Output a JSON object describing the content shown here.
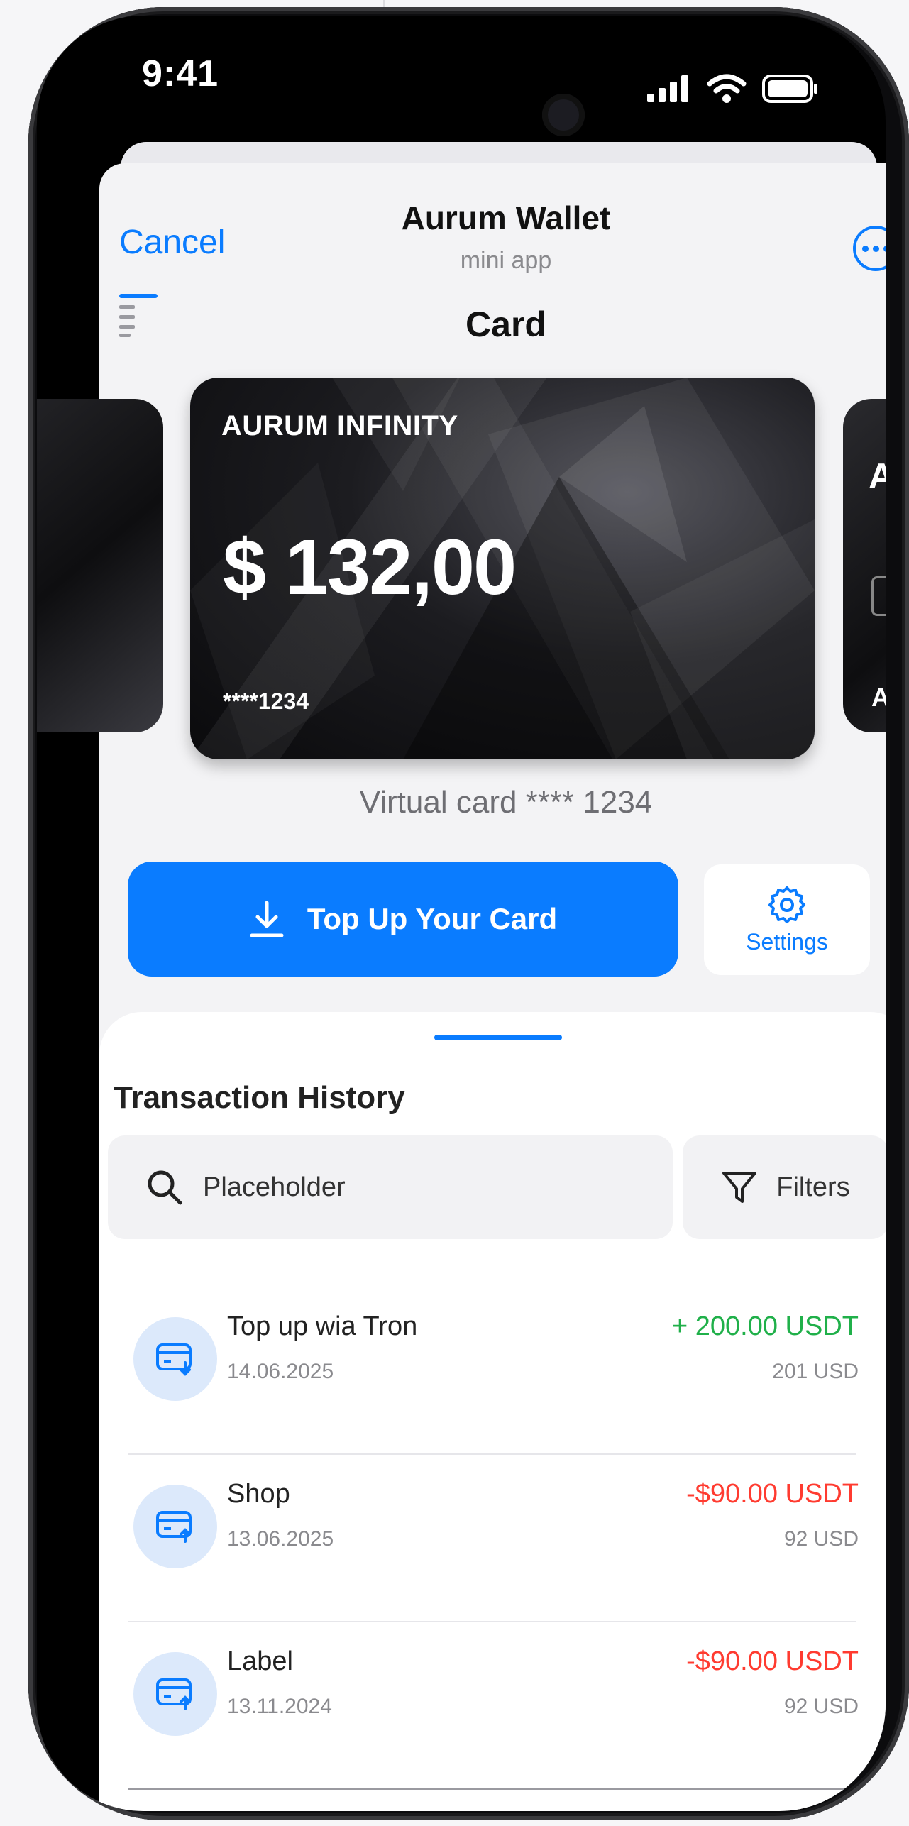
{
  "status_bar": {
    "time": "9:41"
  },
  "header": {
    "cancel_label": "Cancel",
    "app_name": "Aurum Wallet",
    "app_subtitle": "mini app",
    "page_title": "Card"
  },
  "card": {
    "brand": "AURUM INFINITY",
    "balance": "$ 132,00",
    "masked_number": "****1234",
    "virtual_label": "Virtual card **** 1234",
    "next_card_logo": "A",
    "next_card_brand": "AU"
  },
  "actions": {
    "topup_label": "Top Up Your Card",
    "settings_label": "Settings"
  },
  "history": {
    "title": "Transaction History",
    "search_placeholder": "Placeholder",
    "filters_label": "Filters",
    "transactions": [
      {
        "name": "Top up wia Tron",
        "date": "14.06.2025",
        "amount": "+ 200.00 USDT",
        "sub_amount": "201 USD",
        "type": "incoming"
      },
      {
        "name": "Shop",
        "date": "13.06.2025",
        "amount": "-$90.00 USDT",
        "sub_amount": "92 USD",
        "type": "outgoing"
      },
      {
        "name": "Label",
        "date": "13.11.2024",
        "amount": "-$90.00 USDT",
        "sub_amount": "92 USD",
        "type": "outgoing"
      }
    ]
  },
  "colors": {
    "accent": "#0a7cff",
    "positive": "#20b04a",
    "negative": "#ff3b30"
  }
}
